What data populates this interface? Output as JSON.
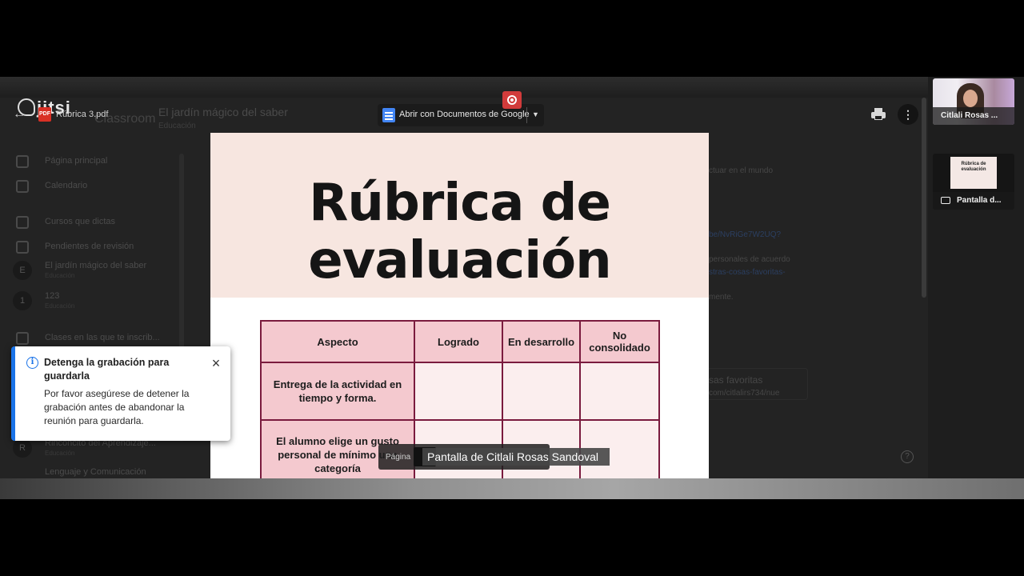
{
  "app": {
    "brand": "jitsi"
  },
  "classroom": {
    "brand": "Classroom",
    "class_title": "El jardín mágico del saber",
    "class_subtitle": "Educación",
    "sidebar": [
      {
        "label": "Página principal"
      },
      {
        "label": "Calendario"
      },
      {
        "label": "Cursos que dictas"
      },
      {
        "label": "Pendientes de revisión"
      },
      {
        "label": "El jardín mágico del saber",
        "sub": "Educación",
        "avatar": "E"
      },
      {
        "label": "123",
        "sub": "Educación",
        "avatar": "1"
      },
      {
        "label": "Clases en las que te inscrib..."
      },
      {
        "label": "Rinconcito del Aprendizaje...",
        "sub": "Educación",
        "avatar": "R"
      },
      {
        "label": "Lenguaje y Comunicación"
      }
    ],
    "right_text": {
      "line1": "ctuar en el mundo",
      "link1": "be/NvRiGe7W2UQ?",
      "line2": "personales de acuerdo",
      "link2": "stras-cosas-favoritas-",
      "line3": "mente.",
      "card_title": "sas favoritas",
      "card_url": "com/citlalirs734/nue"
    }
  },
  "viewer": {
    "file_name": "Rúbrica 3.pdf",
    "pdf_badge": "PDF",
    "open_with_label": "Abrir con Documentos de Google",
    "page_label": "Página"
  },
  "document": {
    "title_line1": "Rúbrica de",
    "title_line2": "evaluación",
    "table": {
      "headers": [
        "Aspecto",
        "Logrado",
        "En desarrollo",
        "No consolidado"
      ],
      "rows": [
        {
          "aspect": "Entrega de la actividad en tiempo y forma."
        },
        {
          "aspect": "El alumno elige un gusto personal de mínimo una categoría"
        }
      ]
    }
  },
  "participants": [
    {
      "name": "Citlali Rosas ..."
    },
    {
      "name": "Pantalla d...",
      "thumb_text": "Rúbrica de evaluación"
    }
  ],
  "notification": {
    "title": "Detenga la grabación para guardarla",
    "body": "Por favor asegúrese de detener la grabación antes de abandonar la reunión para guardarla.",
    "close": "×"
  },
  "caption": "Pantalla de Citlali Rosas Sandoval",
  "colors": {
    "accent": "#1a73e8",
    "record": "#d23b3b",
    "table_border": "#7a1b3e",
    "table_header": "#f4c9cf",
    "banner": "#f7e6e0"
  }
}
